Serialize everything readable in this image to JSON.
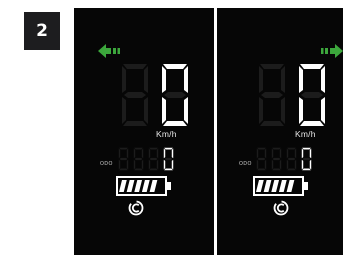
{
  "figure_label": "2",
  "colors": {
    "background": "#ffffff",
    "screen": "#060606",
    "segment_on": "#ffffff",
    "segment_off": "#1c1c1c",
    "turn_signal": "#3ca73c"
  },
  "displays": [
    {
      "id": "left",
      "turn_signal": "left",
      "speed": "0",
      "speed_unit": "Km/h",
      "odometer_label": "ODO",
      "odometer": "0",
      "battery_level": 0.85,
      "assist_icon": "assist-c-icon"
    },
    {
      "id": "right",
      "turn_signal": "right",
      "speed": "0",
      "speed_unit": "Km/h",
      "odometer_label": "ODO",
      "odometer": "0",
      "battery_level": 0.85,
      "assist_icon": "assist-c-icon"
    }
  ]
}
